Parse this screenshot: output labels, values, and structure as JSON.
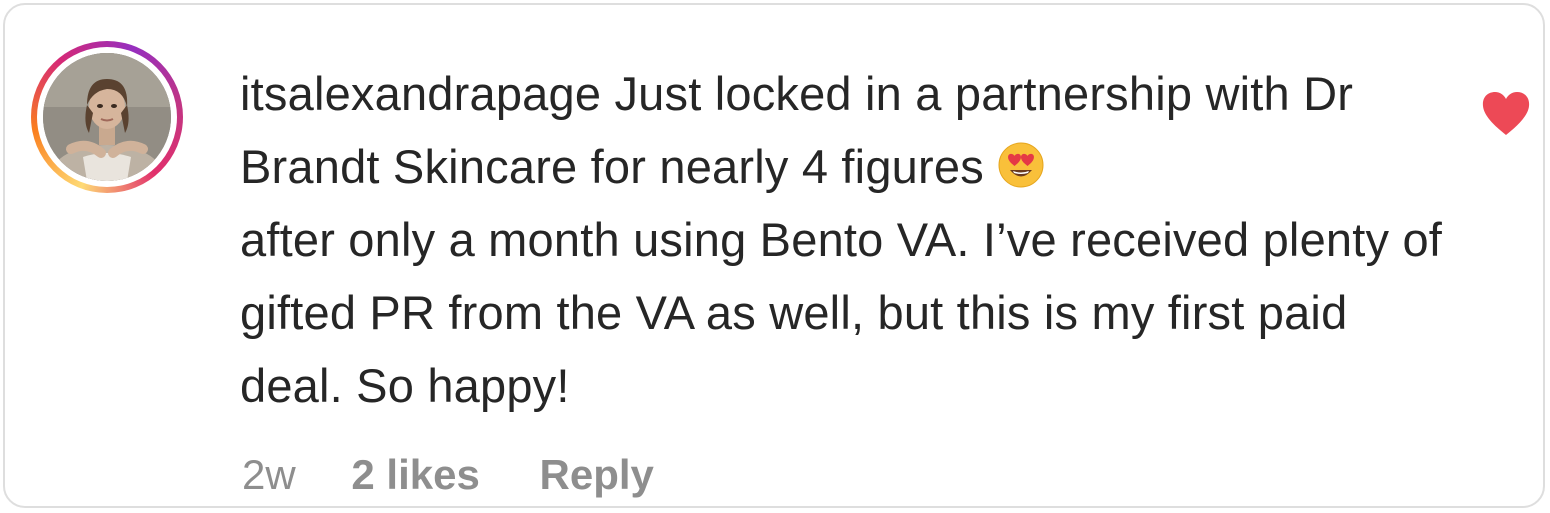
{
  "comment": {
    "username": "itsalexandrapage",
    "text_before_emoji": "Just locked in a partnership with Dr Brandt Skincare for nearly 4 figures",
    "emoji": "heart-eyes-emoji",
    "text_after_emoji": "after only a month using Bento VA. I’ve received plenty of gifted PR from the VA as well, but this is my first paid deal. So happy!",
    "liked": true
  },
  "meta": {
    "timestamp": "2w",
    "likes": "2 likes",
    "reply_label": "Reply"
  },
  "colors": {
    "text": "#262626",
    "meta_text": "#8e8e8e",
    "heart": "#ed4956",
    "border": "#dedede"
  }
}
